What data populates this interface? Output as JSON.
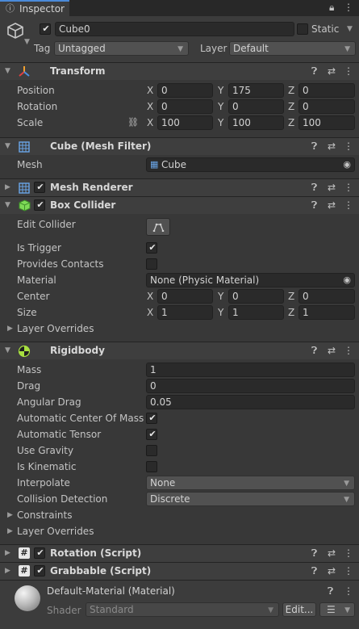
{
  "window": {
    "tab_title": "Inspector"
  },
  "object": {
    "name": "Cube0",
    "static_label": "Static",
    "tag_label": "Tag",
    "tag_value": "Untagged",
    "layer_label": "Layer",
    "layer_value": "Default"
  },
  "transform": {
    "title": "Transform",
    "position": {
      "label": "Position",
      "x": "0",
      "y": "175",
      "z": "0"
    },
    "rotation": {
      "label": "Rotation",
      "x": "0",
      "y": "0",
      "z": "0"
    },
    "scale": {
      "label": "Scale",
      "x": "100",
      "y": "100",
      "z": "100"
    }
  },
  "axes": {
    "x": "X",
    "y": "Y",
    "z": "Z"
  },
  "mesh_filter": {
    "title": "Cube (Mesh Filter)",
    "mesh_label": "Mesh",
    "mesh_value": "Cube"
  },
  "mesh_renderer": {
    "title": "Mesh Renderer"
  },
  "box_collider": {
    "title": "Box Collider",
    "edit_collider": "Edit Collider",
    "is_trigger": "Is Trigger",
    "is_trigger_checked": true,
    "provides_contacts": "Provides Contacts",
    "provides_contacts_checked": false,
    "material_label": "Material",
    "material_value": "None (Physic Material)",
    "center": {
      "label": "Center",
      "x": "0",
      "y": "0",
      "z": "0"
    },
    "size": {
      "label": "Size",
      "x": "1",
      "y": "1",
      "z": "1"
    },
    "layer_overrides": "Layer Overrides"
  },
  "rigidbody": {
    "title": "Rigidbody",
    "mass_label": "Mass",
    "mass": "1",
    "drag_label": "Drag",
    "drag": "0",
    "angular_drag_label": "Angular Drag",
    "angular_drag": "0.05",
    "auto_center_label": "Automatic Center Of Mass",
    "auto_center": true,
    "auto_tensor_label": "Automatic Tensor",
    "auto_tensor": true,
    "use_gravity_label": "Use Gravity",
    "use_gravity": false,
    "is_kinematic_label": "Is Kinematic",
    "is_kinematic": false,
    "interpolate_label": "Interpolate",
    "interpolate": "None",
    "collision_label": "Collision Detection",
    "collision": "Discrete",
    "constraints": "Constraints",
    "layer_overrides": "Layer Overrides"
  },
  "rotation_script": {
    "title": "Rotation (Script)"
  },
  "grabbable_script": {
    "title": "Grabbable (Script)"
  },
  "material": {
    "title": "Default-Material (Material)",
    "shader_label": "Shader",
    "shader_value": "Standard",
    "edit_label": "Edit..."
  },
  "icons": {
    "header_help": "help-icon",
    "header_presets": "presets-icon",
    "header_menu": "kebab-menu-icon"
  },
  "colors": {
    "panel_bg": "#383838",
    "header_bg": "#3e3e3e",
    "field_bg": "#2a2a2a",
    "accent": "#4a8ad9"
  }
}
